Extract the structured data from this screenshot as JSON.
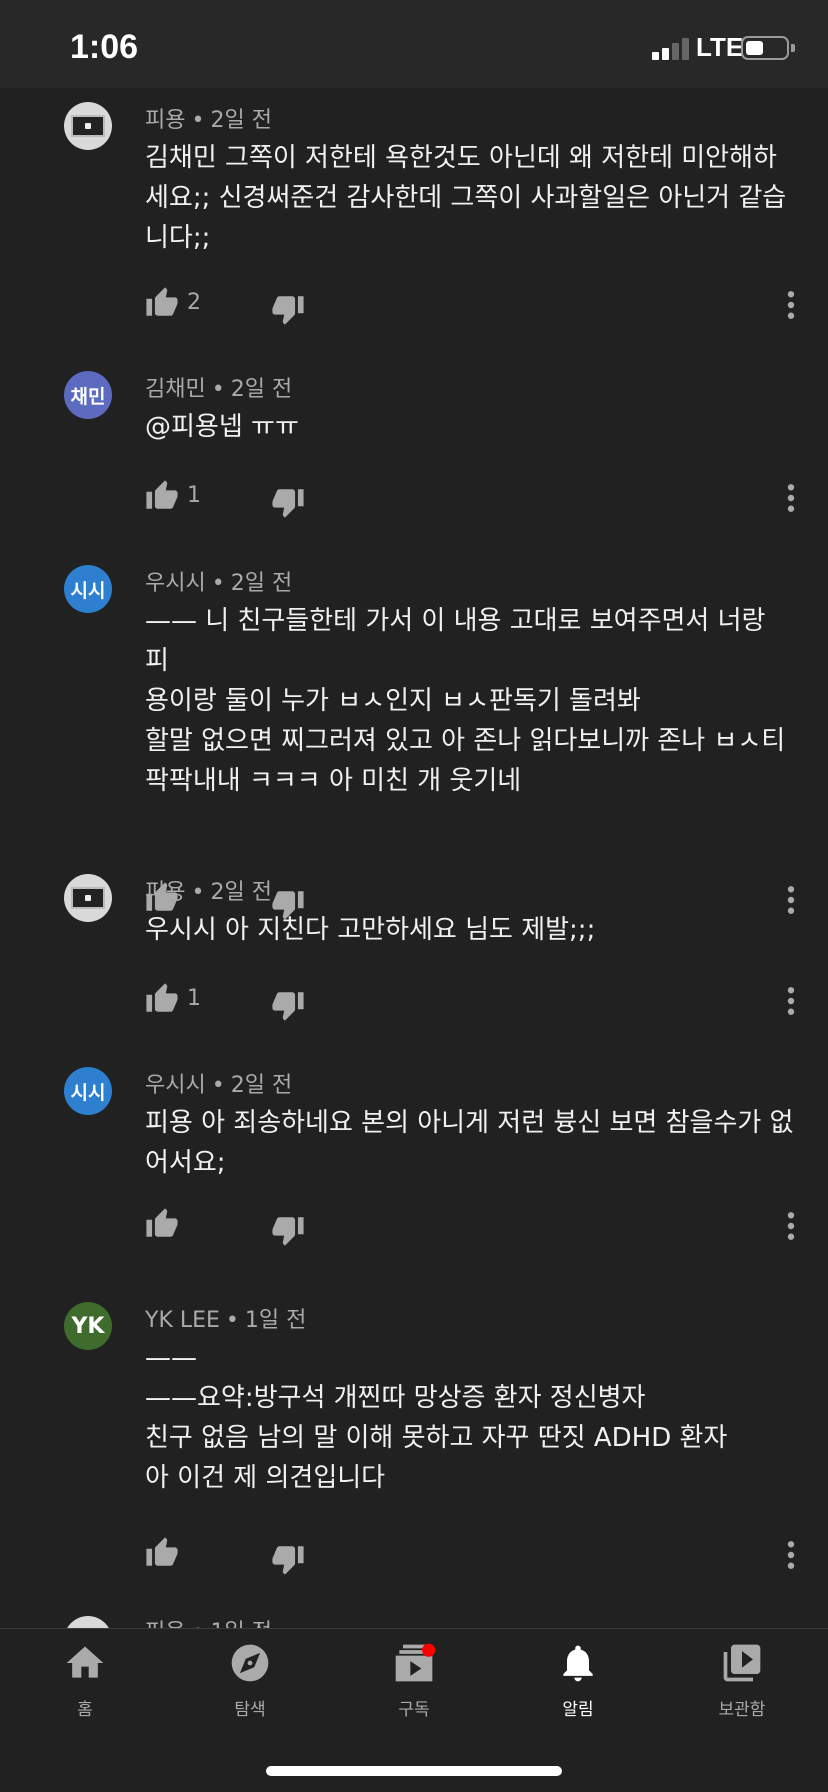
{
  "status_bar": {
    "time": "1:06",
    "network": "LTE"
  },
  "comments": [
    {
      "author": "피용",
      "time": "2일 전",
      "avatar_type": "photo",
      "avatar_text": "",
      "avatar_color": "#d9d9d9",
      "text": "김채민 그쪽이 저한테 욕한것도 아닌데 왜 저한테 미안해하\n세요;; 신경써준건 감사한데 그쪽이 사과할일은 아닌거 같습\n니다;;",
      "likes": "2"
    },
    {
      "author": "김채민",
      "time": "2일 전",
      "avatar_type": "initials",
      "avatar_text": "채민",
      "avatar_color": "#5c6bc0",
      "text": "@피용넵 ㅠㅠ",
      "likes": "1"
    },
    {
      "author": "우시시",
      "time": "2일 전",
      "avatar_type": "initials",
      "avatar_text": "시시",
      "avatar_color": "#2f7fd1",
      "text": "—— 니 친구들한테 가서 이 내용 고대로 보여주면서 너랑 피\n용이랑 둘이 누가 ㅂㅅ인지 ㅂㅅ판독기 돌려봐\n할말 없으면 찌그러져 있고 아 존나 읽다보니까 존나 ㅂㅅ티\n팍팍내내 ㅋㅋㅋ 아 미친 개 웃기네",
      "likes": ""
    },
    {
      "author": "피용",
      "time": "2일 전",
      "avatar_type": "photo",
      "avatar_text": "",
      "avatar_color": "#d9d9d9",
      "text": "우시시 아 지친다 고만하세요 님도 제발;;;",
      "likes": "1"
    },
    {
      "author": "우시시",
      "time": "2일 전",
      "avatar_type": "initials",
      "avatar_text": "시시",
      "avatar_color": "#2f7fd1",
      "text": "피용 아 죄송하네요 본의 아니게 저런 븅신 보면 참을수가 없\n어서요;",
      "likes": ""
    },
    {
      "author": "YK LEE",
      "time": "1일 전",
      "avatar_type": "initials",
      "avatar_text": "YK",
      "avatar_color": "#3f6b2c",
      "text": "——\n——요약:방구석 개찐따 망상증 환자 정신병자\n친구 없음 남의 말 이해 못하고 자꾸 딴짓 ADHD 환자\n아 이건 제 의견입니다",
      "likes": ""
    }
  ],
  "partial_comment": {
    "author": "피용",
    "time": "1일 전"
  },
  "nav": {
    "items": [
      {
        "label": "홈",
        "icon": "home-icon"
      },
      {
        "label": "탐색",
        "icon": "explore-icon"
      },
      {
        "label": "구독",
        "icon": "subscriptions-icon"
      },
      {
        "label": "알림",
        "icon": "notifications-icon"
      },
      {
        "label": "보관함",
        "icon": "library-icon"
      }
    ],
    "active": "알림",
    "badge_color": "#ff0000"
  }
}
